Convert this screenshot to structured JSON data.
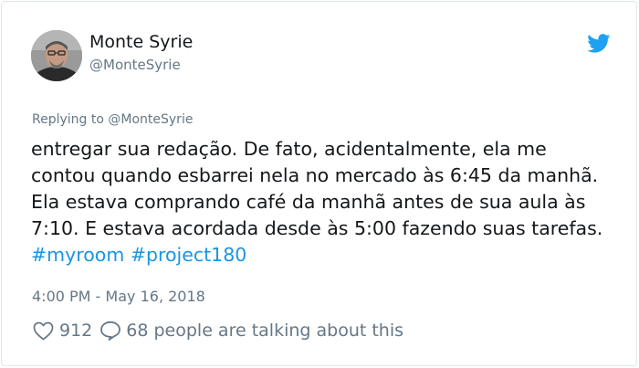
{
  "tweet": {
    "author": {
      "name": "Monte Syrie",
      "handle": "@MonteSyrie"
    },
    "replying_to_prefix": "Replying to ",
    "replying_to_handle": "@MonteSyrie",
    "text_main": "entregar sua redação. De fato, acidentalmente, ela me contou quando esbarrei nela no mercado às 6:45 da manhã. Ela estava comprando café da manhã antes de sua aula às 7:10. E estava acordada desde às 5:00 fazendo suas tarefas.",
    "hashtags": [
      "#myroom",
      "#project180"
    ],
    "timestamp": "4:00 PM - May 16, 2018",
    "like_count": "912",
    "talking_text": "68 people are talking about this"
  },
  "icons": {
    "brand": "twitter-bird-icon",
    "like": "heart-icon",
    "reply": "comment-bubble-icon"
  },
  "colors": {
    "brand_blue": "#1da1f2",
    "hashtag_blue": "#1b95e0",
    "secondary_text": "#657786",
    "primary_text": "#14171a"
  }
}
